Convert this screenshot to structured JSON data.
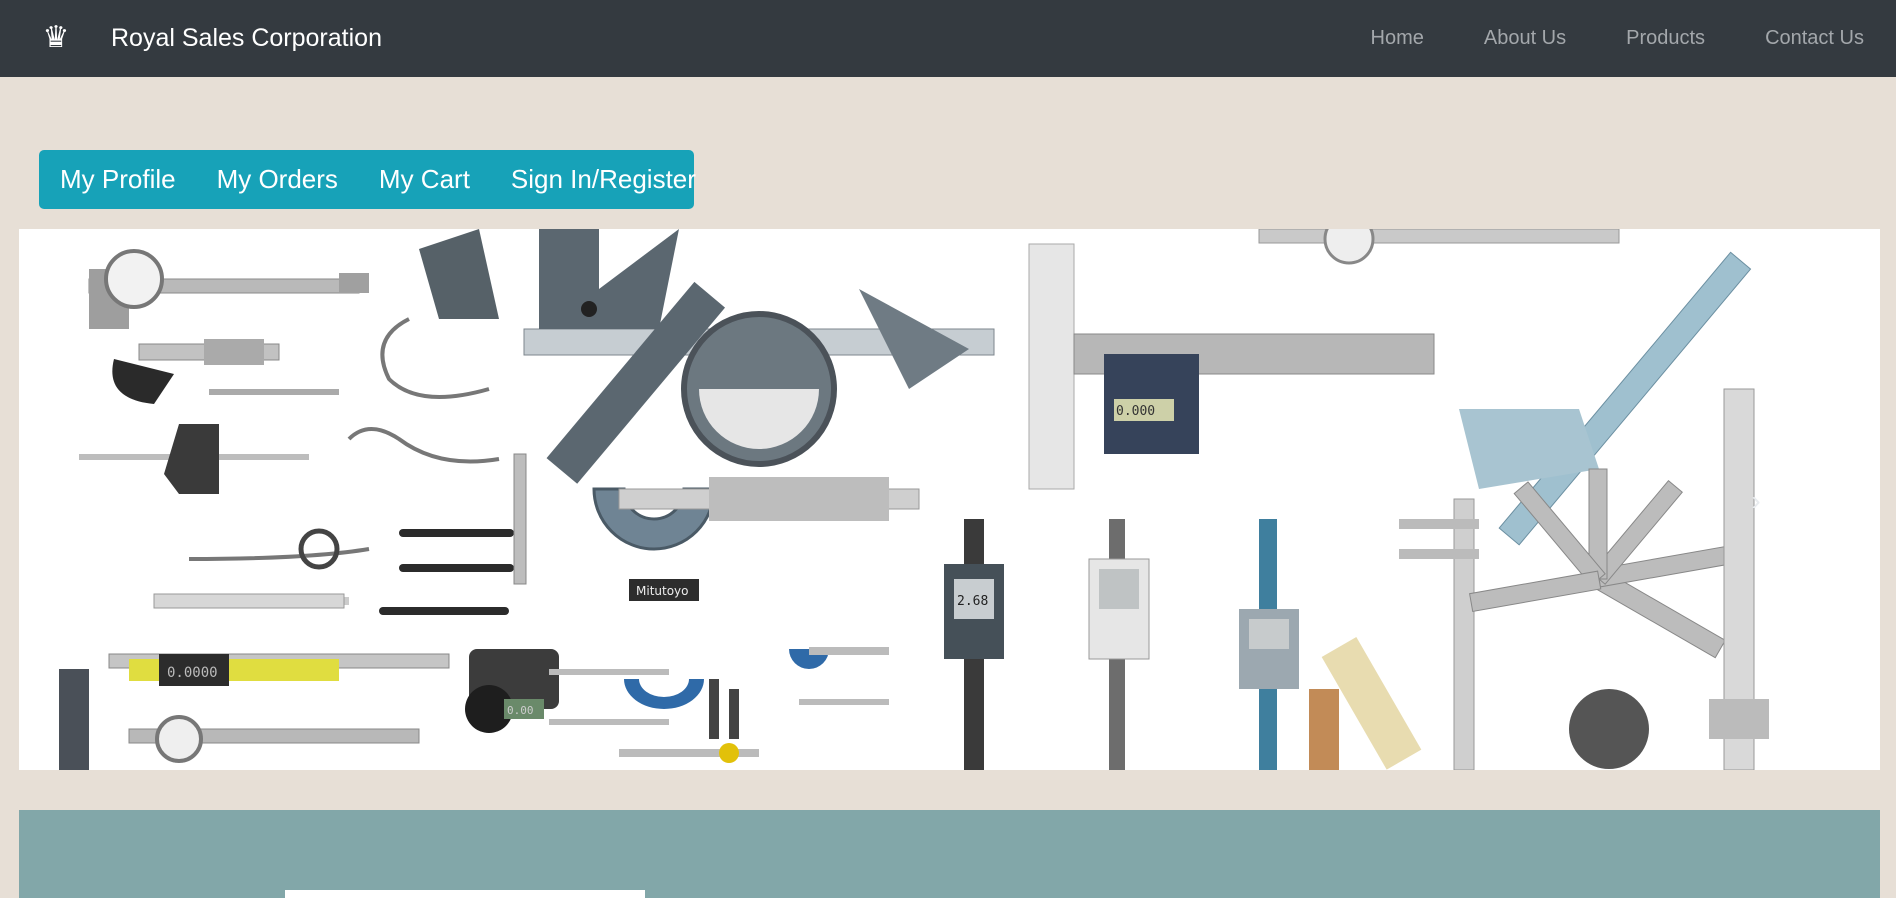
{
  "navbar": {
    "brand_icon": "crown-icon",
    "brand_name": "Royal Sales Corporation",
    "links": [
      {
        "label": "Home"
      },
      {
        "label": "About Us"
      },
      {
        "label": "Products"
      },
      {
        "label": "Contact Us"
      }
    ]
  },
  "user_menu": {
    "items": [
      {
        "label": "My Profile"
      },
      {
        "label": "My Orders"
      },
      {
        "label": "My Cart"
      },
      {
        "label": "Sign In/Register"
      }
    ]
  },
  "banner": {
    "image": "measuring-tools-collage",
    "next_icon": "chevron-right-icon",
    "lcd_readings": [
      "0.0000",
      "2.68",
      "0.000",
      "0.00"
    ],
    "ruler_markings": [
      "Mitutoyo"
    ]
  },
  "colors": {
    "navbar_bg": "#343a40",
    "page_bg": "#e7dfd6",
    "menu_bg": "#17a2b8",
    "lower_section_bg": "#82a7a9"
  }
}
